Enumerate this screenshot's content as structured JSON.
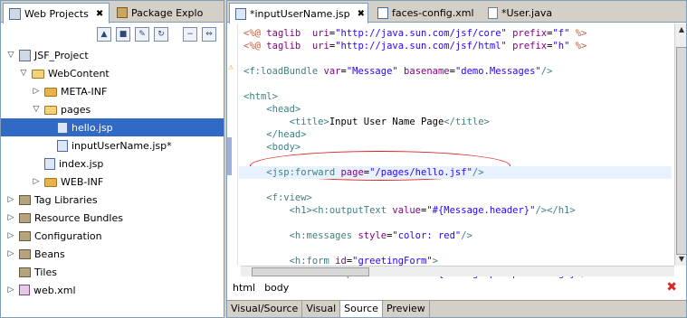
{
  "left": {
    "tabs": [
      {
        "label": "Web Projects",
        "close": "✖"
      },
      {
        "label": "Package Explo"
      }
    ],
    "toolbar_icons": [
      "new-page-icon",
      "new-form-icon",
      "new-tag-icon",
      "refresh-icon",
      "collapse-icon",
      "link-icon"
    ],
    "tree": [
      {
        "label": "JSF_Project",
        "depth": 0,
        "twisty": "▽",
        "icon": "proj"
      },
      {
        "label": "WebContent",
        "depth": 1,
        "twisty": "▽",
        "icon": "folder-open"
      },
      {
        "label": "META-INF",
        "depth": 2,
        "twisty": "▷",
        "icon": "folder"
      },
      {
        "label": "pages",
        "depth": 2,
        "twisty": "▽",
        "icon": "folder-open"
      },
      {
        "label": "hello.jsp",
        "depth": 3,
        "twisty": "",
        "icon": "jsp",
        "selected": true
      },
      {
        "label": "inputUserName.jsp*",
        "depth": 3,
        "twisty": "",
        "icon": "jsp"
      },
      {
        "label": "index.jsp",
        "depth": 2,
        "twisty": "",
        "icon": "jsp"
      },
      {
        "label": "WEB-INF",
        "depth": 2,
        "twisty": "▷",
        "icon": "folder"
      },
      {
        "label": "Tag Libraries",
        "depth": 0,
        "twisty": "▷",
        "icon": "lib"
      },
      {
        "label": "Resource Bundles",
        "depth": 0,
        "twisty": "▷",
        "icon": "lib"
      },
      {
        "label": "Configuration",
        "depth": 0,
        "twisty": "▷",
        "icon": "lib"
      },
      {
        "label": "Beans",
        "depth": 0,
        "twisty": "▷",
        "icon": "lib"
      },
      {
        "label": "Tiles",
        "depth": 0,
        "twisty": "",
        "icon": "lib"
      },
      {
        "label": "web.xml",
        "depth": 0,
        "twisty": "▷",
        "icon": "xml"
      }
    ]
  },
  "editor": {
    "tabs": [
      {
        "label": "*inputUserName.jsp",
        "close": "✖"
      },
      {
        "label": "faces-config.xml"
      },
      {
        "label": "*User.java"
      }
    ],
    "breadcrumb": [
      "html",
      "body"
    ],
    "bottom_tabs": [
      {
        "label": "Visual/Source"
      },
      {
        "label": "Visual"
      },
      {
        "label": "Source",
        "active": true
      },
      {
        "label": "Preview"
      }
    ]
  },
  "code_lines": [
    [
      [
        "dir",
        "<%@ "
      ],
      [
        "attr",
        "taglib"
      ],
      [
        "",
        "  "
      ],
      [
        "attr",
        "uri"
      ],
      [
        "",
        "="
      ],
      [
        "str",
        "\"http://java.sun.com/jsf/core\""
      ],
      [
        "",
        " "
      ],
      [
        "attr",
        "prefix"
      ],
      [
        "",
        "="
      ],
      [
        "str",
        "\"f\""
      ],
      [
        "",
        " "
      ],
      [
        "dir",
        "%>"
      ]
    ],
    [
      [
        "dir",
        "<%@ "
      ],
      [
        "attr",
        "taglib"
      ],
      [
        "",
        "  "
      ],
      [
        "attr",
        "uri"
      ],
      [
        "",
        "="
      ],
      [
        "str",
        "\"http://java.sun.com/jsf/html\""
      ],
      [
        "",
        " "
      ],
      [
        "attr",
        "prefix"
      ],
      [
        "",
        "="
      ],
      [
        "str",
        "\"h\""
      ],
      [
        "",
        " "
      ],
      [
        "dir",
        "%>"
      ]
    ],
    [],
    [
      [
        "tag",
        "<f:loadBundle"
      ],
      [
        "",
        " "
      ],
      [
        "attr",
        "var"
      ],
      [
        "",
        "="
      ],
      [
        "str",
        "\"Message\""
      ],
      [
        "",
        " "
      ],
      [
        "attr",
        "basename"
      ],
      [
        "",
        "="
      ],
      [
        "str",
        "\"demo.Messages\""
      ],
      [
        "tag",
        "/>"
      ]
    ],
    [],
    [
      [
        "tag",
        "<html>"
      ]
    ],
    [
      [
        "",
        "    "
      ],
      [
        "tag",
        "<head>"
      ]
    ],
    [
      [
        "",
        "        "
      ],
      [
        "tag",
        "<title>"
      ],
      [
        "",
        "Input User Name Page"
      ],
      [
        "tag",
        "</title>"
      ]
    ],
    [
      [
        "",
        "    "
      ],
      [
        "tag",
        "</head>"
      ]
    ],
    [
      [
        "",
        "    "
      ],
      [
        "tag",
        "<body>"
      ]
    ],
    [],
    [
      [
        "",
        "    "
      ],
      [
        "tag",
        "<jsp:forward"
      ],
      [
        "",
        " "
      ],
      [
        "attr",
        "page"
      ],
      [
        "",
        "="
      ],
      [
        "str",
        "\"/pages/hello.jsf\""
      ],
      [
        "tag",
        "/>"
      ]
    ],
    [],
    [
      [
        "",
        "    "
      ],
      [
        "tag",
        "<f:view>"
      ]
    ],
    [
      [
        "",
        "        "
      ],
      [
        "tag",
        "<h1>"
      ],
      [
        "tag",
        "<h:outputText"
      ],
      [
        "",
        " "
      ],
      [
        "attr",
        "value"
      ],
      [
        "",
        "="
      ],
      [
        "str",
        "\"#{Message.header}\""
      ],
      [
        "tag",
        "/>"
      ],
      [
        "tag",
        "</h1>"
      ]
    ],
    [],
    [
      [
        "",
        "        "
      ],
      [
        "tag",
        "<h:messages"
      ],
      [
        "",
        " "
      ],
      [
        "attr",
        "style"
      ],
      [
        "",
        "="
      ],
      [
        "str",
        "\"color: red\""
      ],
      [
        "tag",
        "/>"
      ]
    ],
    [],
    [
      [
        "",
        "        "
      ],
      [
        "tag",
        "<h:form"
      ],
      [
        "",
        " "
      ],
      [
        "attr",
        "id"
      ],
      [
        "",
        "="
      ],
      [
        "str",
        "\"greetingForm\""
      ],
      [
        "tag",
        ">"
      ]
    ],
    [
      [
        "",
        "            "
      ],
      [
        "tag",
        "<h:outputText"
      ],
      [
        "",
        " "
      ],
      [
        "attr",
        "value"
      ],
      [
        "",
        "="
      ],
      [
        "str",
        "\"#{Message.prompt_message}\""
      ],
      [
        "tag",
        "/>"
      ]
    ]
  ]
}
